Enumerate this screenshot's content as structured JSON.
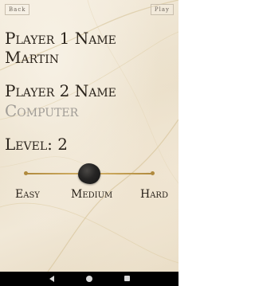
{
  "header": {
    "back_label": "Back",
    "play_label": "Play"
  },
  "player1": {
    "label": "Player 1 Name",
    "value": "Martin"
  },
  "player2": {
    "label": "Player 2 Name",
    "value": "Computer"
  },
  "level": {
    "label": "Level: 2",
    "options": [
      "Easy",
      "Medium",
      "Hard"
    ],
    "selected_index": 1,
    "slider_fraction": 0.5
  },
  "colors": {
    "slider_track": "#b08a3e",
    "slider_thumb": "#262524",
    "text": "#2a231b",
    "placeholder_text": "#a09c96"
  },
  "icons": {
    "nav_back": "triangle-back-icon",
    "nav_home": "circle-home-icon",
    "nav_recent": "square-recent-icon"
  }
}
